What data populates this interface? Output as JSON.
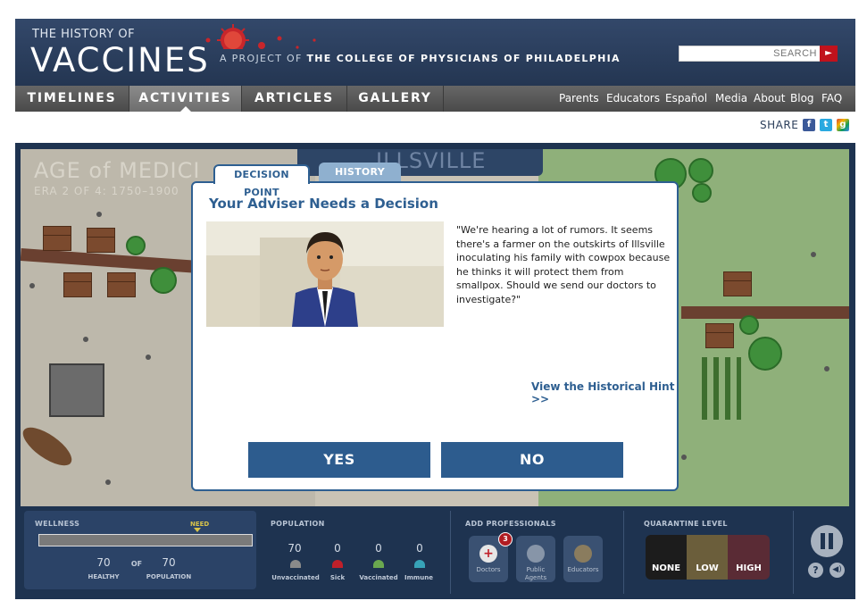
{
  "header": {
    "logo_top": "THE HISTORY OF",
    "logo_main": "VACCINES",
    "tagline_prefix": "A PROJECT OF",
    "tagline_org": "THE COLLEGE OF PHYSICIANS OF PHILADELPHIA",
    "search_placeholder": "SEARCH",
    "search_button": "►"
  },
  "nav": {
    "main": [
      "TIMELINES",
      "ACTIVITIES",
      "ARTICLES",
      "GALLERY"
    ],
    "active": "ACTIVITIES",
    "right": [
      "Parents",
      "Educators",
      "Español",
      "Media",
      "About",
      "Blog",
      "FAQ"
    ]
  },
  "share": {
    "label": "SHARE",
    "icons": [
      "facebook-icon",
      "twitter-icon",
      "google-icon"
    ]
  },
  "map": {
    "era_title": "AGE of MEDICI",
    "era_sub": "ERA 2 OF 4: 1750–1900",
    "town": "ILLSVILLE"
  },
  "modal": {
    "tabs": [
      "DECISION POINT",
      "HISTORY"
    ],
    "active_tab": "DECISION POINT",
    "title": "Your Adviser Needs a Decision",
    "quote": "\"We're hearing a lot of rumors. It seems there's a farmer on the outskirts of Illsville inoculating his family with cowpox because he thinks it will protect them from smallpox. Should we send our doctors to investigate?\"",
    "hint_link": "View the Historical Hint >>",
    "yes_label": "YES",
    "no_label": "NO"
  },
  "panel": {
    "wellness": {
      "label": "WELLNESS",
      "need_label": "NEED",
      "healthy_value": "70",
      "of_label": "OF",
      "population_value": "70",
      "healthy_label": "HEALTHY",
      "population_label": "POPULATION"
    },
    "population": {
      "label": "POPULATION",
      "groups": [
        {
          "value": "70",
          "label": "Unvaccinated",
          "color": "#8a8a8a"
        },
        {
          "value": "0",
          "label": "Sick",
          "color": "#c0202a"
        },
        {
          "value": "0",
          "label": "Vaccinated",
          "color": "#6aa84f"
        },
        {
          "value": "0",
          "label": "Immune",
          "color": "#37a3b8"
        }
      ]
    },
    "professionals": {
      "label": "ADD PROFESSIONALS",
      "items": [
        {
          "label": "Doctors",
          "badge": "3"
        },
        {
          "label": "Public Agents"
        },
        {
          "label": "Educators"
        }
      ]
    },
    "quarantine": {
      "label": "QUARANTINE LEVEL",
      "levels": [
        "NONE",
        "LOW",
        "HIGH"
      ],
      "colors": [
        "#1c1c1c",
        "#6b5e3b",
        "#5a2b35"
      ]
    },
    "help_label": "?",
    "sound_label": "◀)"
  }
}
